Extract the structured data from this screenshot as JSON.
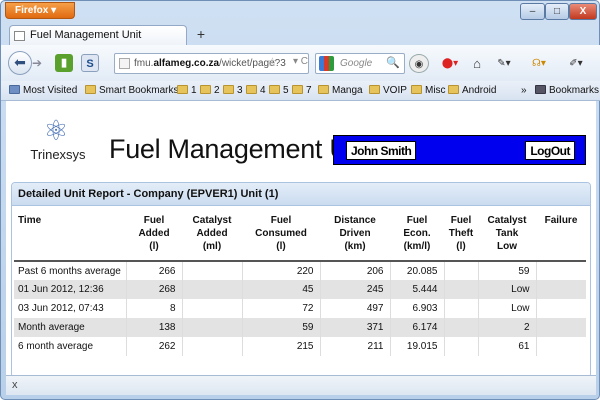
{
  "browser": {
    "app_button": "Firefox",
    "tab_title": "Fuel Management Unit",
    "new_tab": "+",
    "url_prefix": "fmu.",
    "url_domain": "alfameg.co.za",
    "url_path": "/wicket/page?3",
    "search_placeholder": "Google",
    "window_controls": {
      "minimize": "–",
      "maximize": "□",
      "close": "X"
    }
  },
  "bookmarks": {
    "most_visited": "Most Visited",
    "items": [
      "Smart Bookmarks",
      "1",
      "2",
      "3",
      "4",
      "5",
      "7",
      "Manga",
      "VOIP",
      "Misc",
      "Android"
    ],
    "overflow": "»",
    "bookmarks_menu": "Bookmarks"
  },
  "app": {
    "logo_text": "Trinexsys",
    "title": "Fuel Management Unit",
    "user_name": "John Smith",
    "logout_label": "LogOut",
    "accent_color": "#0000ee"
  },
  "report": {
    "title": "Detailed Unit Report - Company (EPVER1) Unit (1)",
    "columns": [
      [
        "Time"
      ],
      [
        "Fuel",
        "Added",
        "(l)"
      ],
      [
        "Catalyst",
        "Added",
        "(ml)"
      ],
      [
        "Fuel",
        "Consumed",
        "(l)"
      ],
      [
        "Distance",
        "Driven",
        "(km)"
      ],
      [
        "Fuel",
        "Econ.",
        "(km/l)"
      ],
      [
        "Fuel",
        "Theft",
        "(l)"
      ],
      [
        "Catalyst",
        "Tank",
        "Low"
      ],
      [
        "Failure"
      ]
    ],
    "rows": [
      [
        "Past 6 months average",
        "266",
        "",
        "220",
        "206",
        "20.085",
        "",
        "59",
        ""
      ],
      [
        "01 Jun 2012, 12:36",
        "268",
        "",
        "45",
        "245",
        "5.444",
        "",
        "Low",
        ""
      ],
      [
        "03 Jun 2012, 07:43",
        "8",
        "",
        "72",
        "497",
        "6.903",
        "",
        "Low",
        ""
      ],
      [
        "Month average",
        "138",
        "",
        "59",
        "371",
        "6.174",
        "",
        "2",
        ""
      ],
      [
        "6 month average",
        "262",
        "",
        "215",
        "211",
        "19.015",
        "",
        "61",
        ""
      ]
    ]
  },
  "statusbar": {
    "close_label": "x"
  }
}
